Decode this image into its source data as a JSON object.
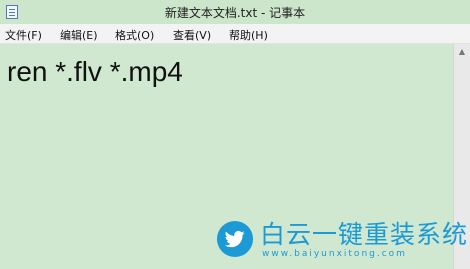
{
  "window": {
    "title": "新建文本文档.txt - 记事本"
  },
  "menu": {
    "items": [
      {
        "label": "文件(F)"
      },
      {
        "label": "编辑(E)"
      },
      {
        "label": "格式(O)"
      },
      {
        "label": "查看(V)"
      },
      {
        "label": "帮助(H)"
      }
    ]
  },
  "editor": {
    "content": "ren *.flv *.mp4"
  },
  "watermark": {
    "text": "白云一键重装系统",
    "url": "www.baiyunxitong.com",
    "icon": "twitter-bird-icon",
    "color": "#1c9ad6"
  },
  "colors": {
    "background": "#cfe8cf",
    "menubar": "#f3f3f3"
  }
}
